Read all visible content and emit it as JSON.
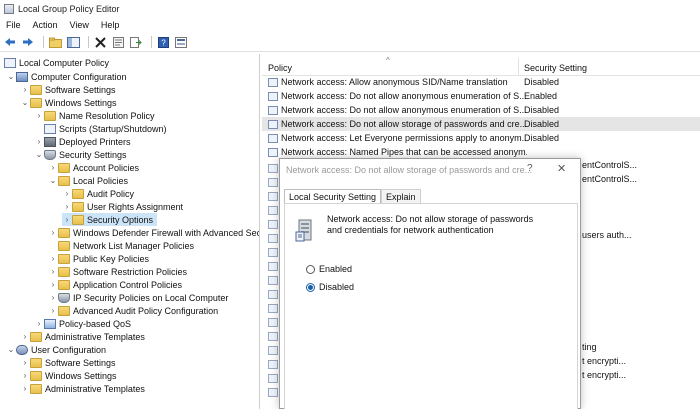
{
  "window": {
    "title": "Local Group Policy Editor"
  },
  "menu": [
    "File",
    "Action",
    "View",
    "Help"
  ],
  "toolbar": {
    "buttons": [
      "back-arrow-icon",
      "forward-arrow-icon",
      "up-folder-icon",
      "show-hide-tree-icon",
      "delete-icon",
      "properties-icon",
      "export-list-icon",
      "help-icon",
      "view-icon"
    ]
  },
  "tree": {
    "root": "Local Computer Policy",
    "items": [
      "Computer Configuration",
      "Software Settings",
      "Windows Settings",
      "Name Resolution Policy",
      "Scripts (Startup/Shutdown)",
      "Deployed Printers",
      "Security Settings",
      "Account Policies",
      "Local Policies",
      "Audit Policy",
      "User Rights Assignment",
      "Security Options",
      "Windows Defender Firewall with Advanced Secu",
      "Network List Manager Policies",
      "Public Key Policies",
      "Software Restriction Policies",
      "Application Control Policies",
      "IP Security Policies on Local Computer",
      "Advanced Audit Policy Configuration",
      "Policy-based QoS",
      "Administrative Templates",
      "User Configuration",
      "Software Settings",
      "Windows Settings",
      "Administrative Templates"
    ]
  },
  "list": {
    "columns": [
      "Policy",
      "Security Setting"
    ],
    "rows": [
      {
        "policy": "Network access: Allow anonymous SID/Name translation",
        "setting": "Disabled"
      },
      {
        "policy": "Network access: Do not allow anonymous enumeration of S...",
        "setting": "Enabled"
      },
      {
        "policy": "Network access: Do not allow anonymous enumeration of S...",
        "setting": "Disabled"
      },
      {
        "policy": "Network access: Do not allow storage of passwords and cre...",
        "setting": "Disabled"
      },
      {
        "policy": "Network access: Let Everyone permissions apply to anonym...",
        "setting": "Disabled"
      },
      {
        "policy": "Network access: Named Pipes that can be accessed anonym...",
        "setting": ""
      }
    ],
    "fragments": [
      "entControlS...",
      "entControlS...",
      "users auth...",
      "ting",
      "t encrypti...",
      "t encrypti..."
    ]
  },
  "dialog": {
    "title": "Network access: Do not allow storage of passwords and cre...",
    "help": "?",
    "close": "✕",
    "tabs": [
      "Local Security Setting",
      "Explain"
    ],
    "description": "Network access: Do not allow storage of passwords and credentials for network authentication",
    "options": [
      "Enabled",
      "Disabled"
    ],
    "selected_option": "Disabled"
  }
}
